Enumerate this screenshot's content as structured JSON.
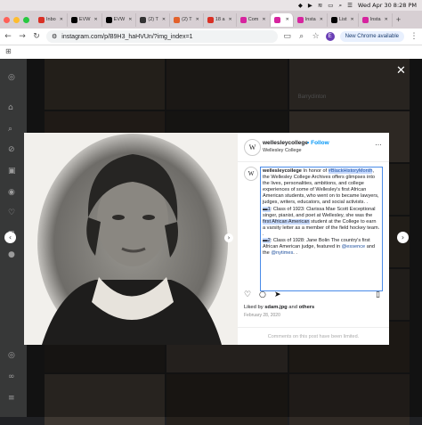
{
  "menubar": {
    "datetime": "Wed Apr 30  8:28 PM"
  },
  "tabs": [
    {
      "label": "Inbo",
      "color": "#d93025"
    },
    {
      "label": "EVW",
      "color": "#000000"
    },
    {
      "label": "EVW",
      "color": "#000000"
    },
    {
      "label": "(2) T",
      "color": "#333333"
    },
    {
      "label": "(2) T",
      "color": "#e2612b"
    },
    {
      "label": "18 a",
      "color": "#d93025"
    },
    {
      "label": "Com",
      "color": "#d6249f"
    },
    {
      "label": "",
      "color": "#d6249f",
      "active": true
    },
    {
      "label": "Insta",
      "color": "#d6249f"
    },
    {
      "label": "List",
      "color": "#000000"
    },
    {
      "label": "Insta",
      "color": "#d6249f"
    }
  ],
  "address": {
    "url": "instagram.com/p/B9H3_haHVUn/?img_index=1",
    "profile_initial": "E",
    "update_label": "New Chrome available"
  },
  "background": {
    "tile_label": "Barryclinton"
  },
  "post": {
    "username": "wellesleycollege",
    "follow_label": "Follow",
    "subtitle": "Wellesley College",
    "caption_user": "wellesleycollege",
    "caption_p1_a": " In honor of ",
    "caption_hashtag": "#BlackHistoryMonth",
    "caption_p1_b": ", the Wellesley College Archives offers glimpses into the lives, personalities, ambitions, and college experiences of some of Wellesley's first African American students, who went on to became lawyers, judges, writers, educators, and social activists. .",
    "caption_p2_a": ": Class of 1923: Clarissa Mae Scott Exceptional singer, pianist, and poet at Wellesley, she was the ",
    "caption_p2_hl": "first African American",
    "caption_p2_b": " student at the College to earn a varsity letter as a member of the field hockey team. .",
    "caption_p3_a": ": Class of 1928: Jane Bolin The country's first African American judge, featured in ",
    "caption_mention1": "@essence",
    "caption_p3_b": " and the ",
    "caption_mention2": "@nytimes",
    "caption_p3_c": ". .",
    "likes_prefix": "Liked by ",
    "likes_user": "sdam.jpg",
    "likes_mid": " and ",
    "likes_others": "others",
    "date": "February 28, 2020",
    "comments_limited": "Comments on this post have been limited."
  },
  "colors": {
    "accent": "#0095f6",
    "highlight": "#c8dbff"
  }
}
